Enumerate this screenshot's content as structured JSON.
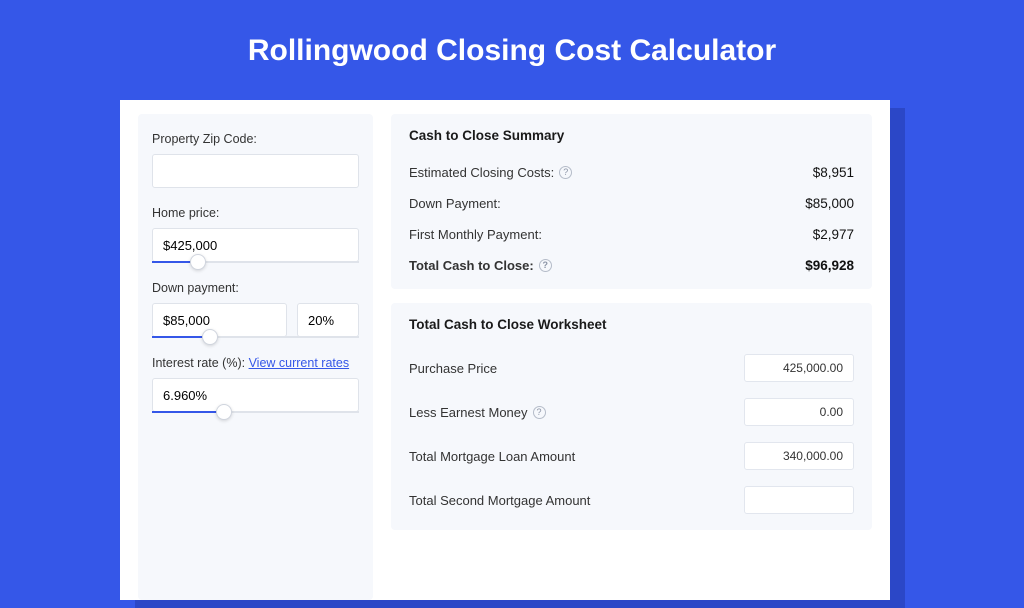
{
  "title": "Rollingwood Closing Cost Calculator",
  "left": {
    "zip": {
      "label": "Property Zip Code:",
      "value": ""
    },
    "price": {
      "label": "Home price:",
      "value": "$425,000",
      "slider_fill_pct": 22
    },
    "down": {
      "label": "Down payment:",
      "value": "$85,000",
      "pct": "20%",
      "slider_fill_pct": 28
    },
    "rate": {
      "label_prefix": "Interest rate (%): ",
      "link_text": "View current rates",
      "value": "6.960%",
      "slider_fill_pct": 35
    }
  },
  "summary": {
    "title": "Cash to Close Summary",
    "rows": [
      {
        "label": "Estimated Closing Costs:",
        "help": true,
        "value": "$8,951",
        "bold": false
      },
      {
        "label": "Down Payment:",
        "help": false,
        "value": "$85,000",
        "bold": false
      },
      {
        "label": "First Monthly Payment:",
        "help": false,
        "value": "$2,977",
        "bold": false
      },
      {
        "label": "Total Cash to Close:",
        "help": true,
        "value": "$96,928",
        "bold": true
      }
    ]
  },
  "worksheet": {
    "title": "Total Cash to Close Worksheet",
    "rows": [
      {
        "label": "Purchase Price",
        "help": false,
        "value": "425,000.00"
      },
      {
        "label": "Less Earnest Money",
        "help": true,
        "value": "0.00"
      },
      {
        "label": "Total Mortgage Loan Amount",
        "help": false,
        "value": "340,000.00"
      },
      {
        "label": "Total Second Mortgage Amount",
        "help": false,
        "value": ""
      }
    ]
  }
}
